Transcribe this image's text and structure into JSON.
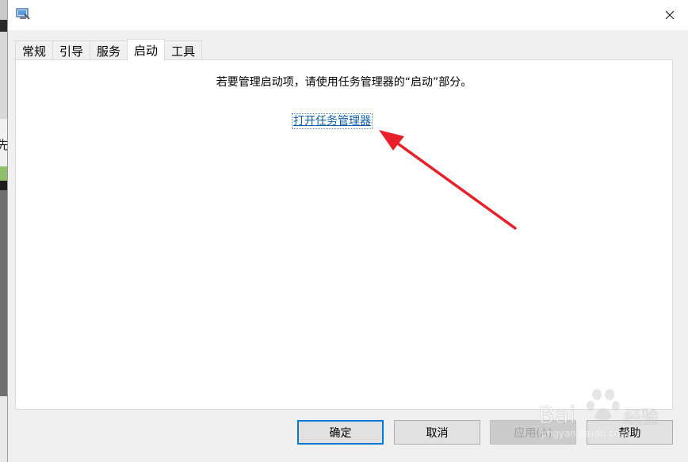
{
  "tabs": [
    {
      "label": "常规",
      "active": false
    },
    {
      "label": "引导",
      "active": false
    },
    {
      "label": "服务",
      "active": false
    },
    {
      "label": "启动",
      "active": true
    },
    {
      "label": "工具",
      "active": false
    }
  ],
  "startup": {
    "info_text": "若要管理启动项，请使用任务管理器的“启动”部分。",
    "link_label": "打开任务管理器"
  },
  "buttons": {
    "ok": "确定",
    "cancel": "取消",
    "apply": "应用(A)",
    "help": "帮助"
  },
  "background": {
    "left_char": "先"
  },
  "watermark": {
    "brand": "Baidu 经验",
    "url": "jingyan.baidu.com"
  },
  "colors": {
    "link": "#0b5ca8",
    "primary_border": "#0078d7",
    "annotation_arrow": "#e8202a"
  },
  "icons": {
    "app": "msconfig-icon",
    "close": "close-icon"
  }
}
